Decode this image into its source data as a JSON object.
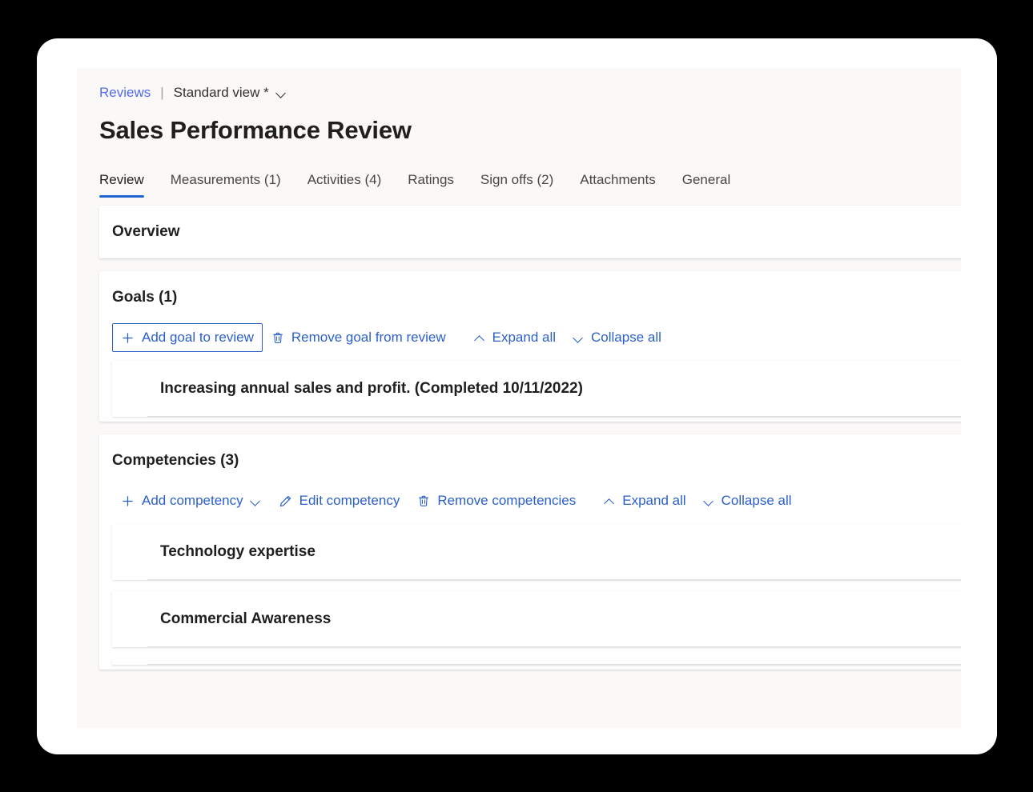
{
  "header": {
    "breadcrumb": {
      "link_label": "Reviews",
      "separator": "|",
      "view_label": "Standard view *",
      "view_chevron_icon": "chevron-down-icon"
    },
    "title": "Sales Performance Review"
  },
  "tabs": [
    {
      "label": "Review",
      "active": true
    },
    {
      "label": "Measurements (1)",
      "active": false
    },
    {
      "label": "Activities (4)",
      "active": false
    },
    {
      "label": "Ratings",
      "active": false
    },
    {
      "label": "Sign offs (2)",
      "active": false
    },
    {
      "label": "Attachments",
      "active": false
    },
    {
      "label": "General",
      "active": false
    }
  ],
  "sections": {
    "overview": {
      "title": "Overview"
    },
    "goals": {
      "title": "Goals (1)",
      "commands": [
        {
          "label": "Add goal to review",
          "icon": "plus-icon",
          "focused": true
        },
        {
          "label": "Remove goal from review",
          "icon": "trash-icon",
          "focused": false
        },
        {
          "label": "Expand all",
          "icon": "chevron-up-icon",
          "focused": false
        },
        {
          "label": "Collapse all",
          "icon": "chevron-down-icon",
          "focused": false
        }
      ],
      "items": [
        {
          "label": "Increasing annual sales and profit. (Completed 10/11/2022)"
        }
      ]
    },
    "competencies": {
      "title": "Competencies (3)",
      "commands": [
        {
          "label": "Add competency",
          "icon": "plus-icon",
          "trailing_icon": "chevron-down-icon",
          "focused": false
        },
        {
          "label": "Edit competency",
          "icon": "pencil-icon",
          "focused": false
        },
        {
          "label": "Remove competencies",
          "icon": "trash-icon",
          "focused": false
        },
        {
          "label": "Expand all",
          "icon": "chevron-up-icon",
          "focused": false
        },
        {
          "label": "Collapse all",
          "icon": "chevron-down-icon",
          "focused": false
        }
      ],
      "items": [
        {
          "label": "Technology expertise"
        },
        {
          "label": "Commercial Awareness"
        }
      ]
    }
  },
  "colors": {
    "accent": "#2564cf",
    "link": "#4f6bed",
    "command": "#2b5fc9",
    "page_background": "#faf9f8",
    "card_background": "#ffffff",
    "text_primary": "#201f1e"
  }
}
